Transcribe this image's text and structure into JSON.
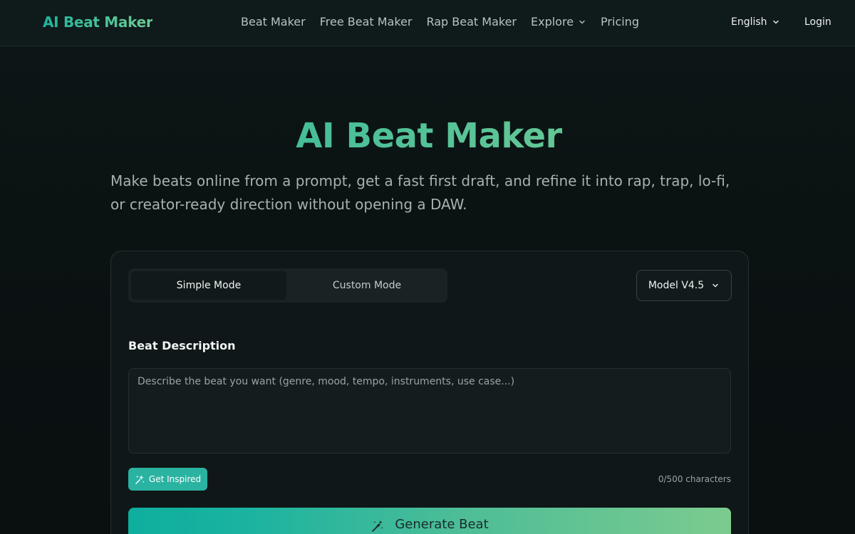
{
  "header": {
    "logo": "AI Beat Maker",
    "nav": [
      {
        "label": "Beat Maker"
      },
      {
        "label": "Free Beat Maker"
      },
      {
        "label": "Rap Beat Maker"
      },
      {
        "label": "Explore",
        "icon": "chevron-down-icon"
      },
      {
        "label": "Pricing"
      }
    ],
    "language": "English",
    "login": "Login"
  },
  "hero": {
    "title": "AI Beat Maker",
    "subtitle": "Make beats online from a prompt, get a fast first draft, and refine it into rap, trap, lo-fi, or creator-ready direction without opening a DAW."
  },
  "card": {
    "modes": [
      {
        "label": "Simple Mode",
        "active": true
      },
      {
        "label": "Custom Mode",
        "active": false
      }
    ],
    "model": "Model V4.5",
    "field_label": "Beat Description",
    "description": {
      "value": "",
      "placeholder": "Describe the beat you want (genre, mood, tempo, instruments, use case...)"
    },
    "inspire_label": "Get Inspired",
    "char_count": "0/500 characters",
    "generate_label": "Generate Beat"
  },
  "colors": {
    "accent": "#2bb3a2",
    "gradient_start": "#0eae9e",
    "gradient_end": "#7ccb8e",
    "background": "#0b1212"
  }
}
